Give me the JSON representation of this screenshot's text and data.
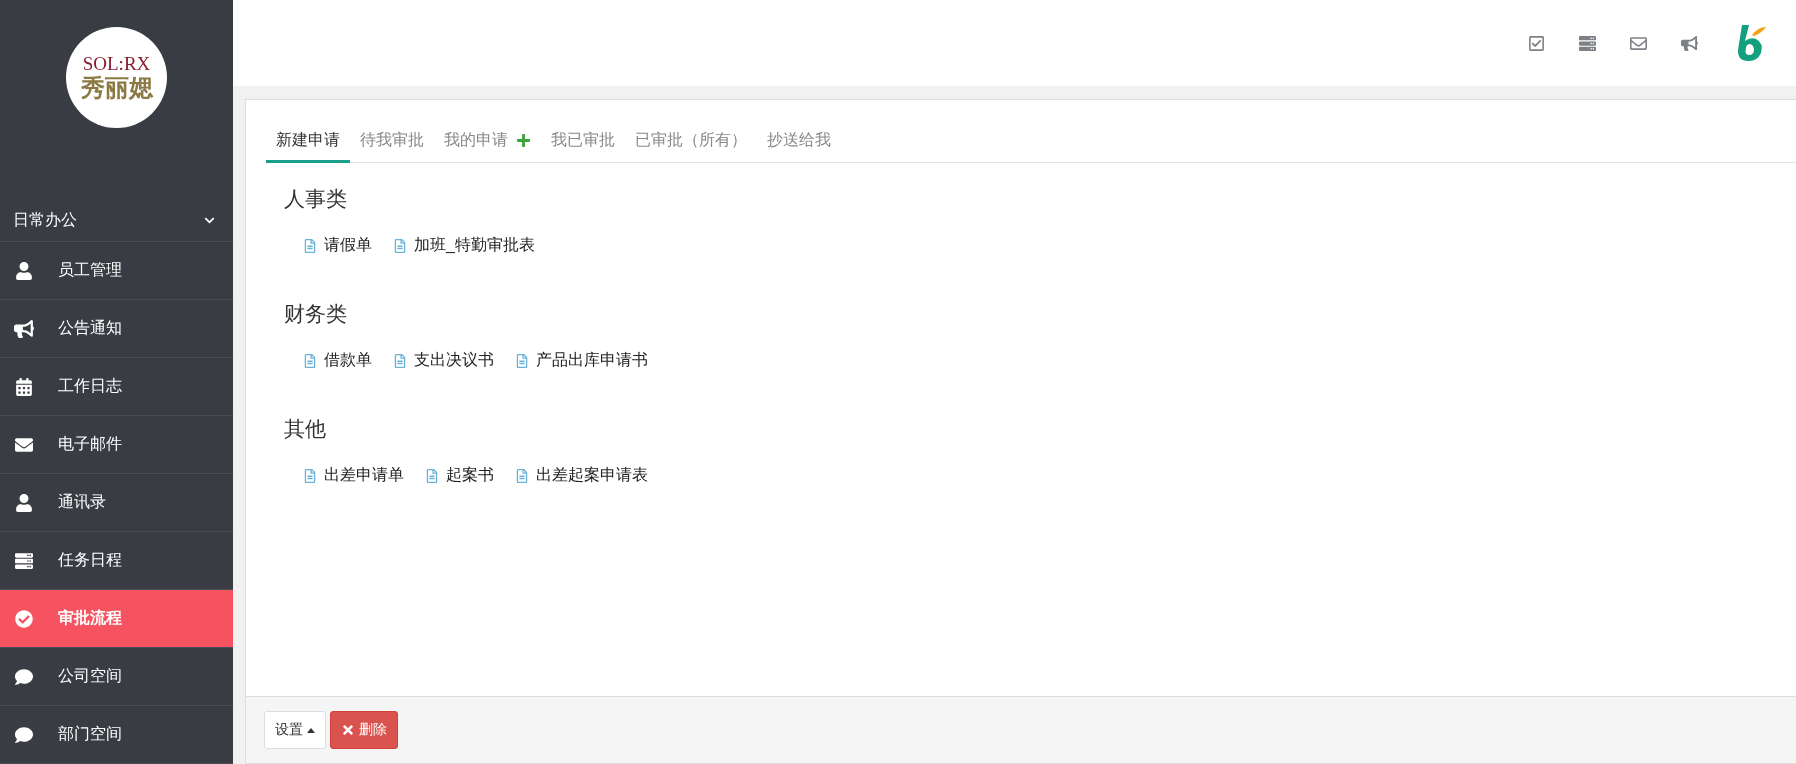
{
  "sidebar": {
    "logo": {
      "brand": "SOL:RX",
      "name": "秀丽媤"
    },
    "section": {
      "label": "日常办公",
      "expanded": true
    },
    "items": [
      {
        "label": "员工管理",
        "selected": false
      },
      {
        "label": "公告通知",
        "selected": false
      },
      {
        "label": "工作日志",
        "selected": false
      },
      {
        "label": "电子邮件",
        "selected": false
      },
      {
        "label": "通讯录",
        "selected": false
      },
      {
        "label": "任务日程",
        "selected": false
      },
      {
        "label": "审批流程",
        "selected": true
      },
      {
        "label": "公司空间",
        "selected": false
      },
      {
        "label": "部门空间",
        "selected": false
      }
    ]
  },
  "tabs": [
    {
      "label": "新建申请",
      "selected": true,
      "add": false
    },
    {
      "label": "待我审批",
      "selected": false,
      "add": false
    },
    {
      "label": "我的申请",
      "selected": false,
      "add": true
    },
    {
      "label": "我已审批",
      "selected": false,
      "add": false
    },
    {
      "label": "已审批（所有）",
      "selected": false,
      "add": false
    },
    {
      "label": "抄送给我",
      "selected": false,
      "add": false
    }
  ],
  "categories": [
    {
      "title": "人事类",
      "forms": [
        "请假单",
        "加班_特勤审批表"
      ]
    },
    {
      "title": "财务类",
      "forms": [
        "借款单",
        "支出决议书",
        "产品出库申请书"
      ]
    },
    {
      "title": "其他",
      "forms": [
        "出差申请单",
        "起案书",
        "出差起案申请表"
      ]
    }
  ],
  "footer": {
    "buttons": [
      {
        "label": "设置",
        "kind": "dropdown"
      },
      {
        "label": "删除",
        "kind": "danger"
      }
    ]
  }
}
